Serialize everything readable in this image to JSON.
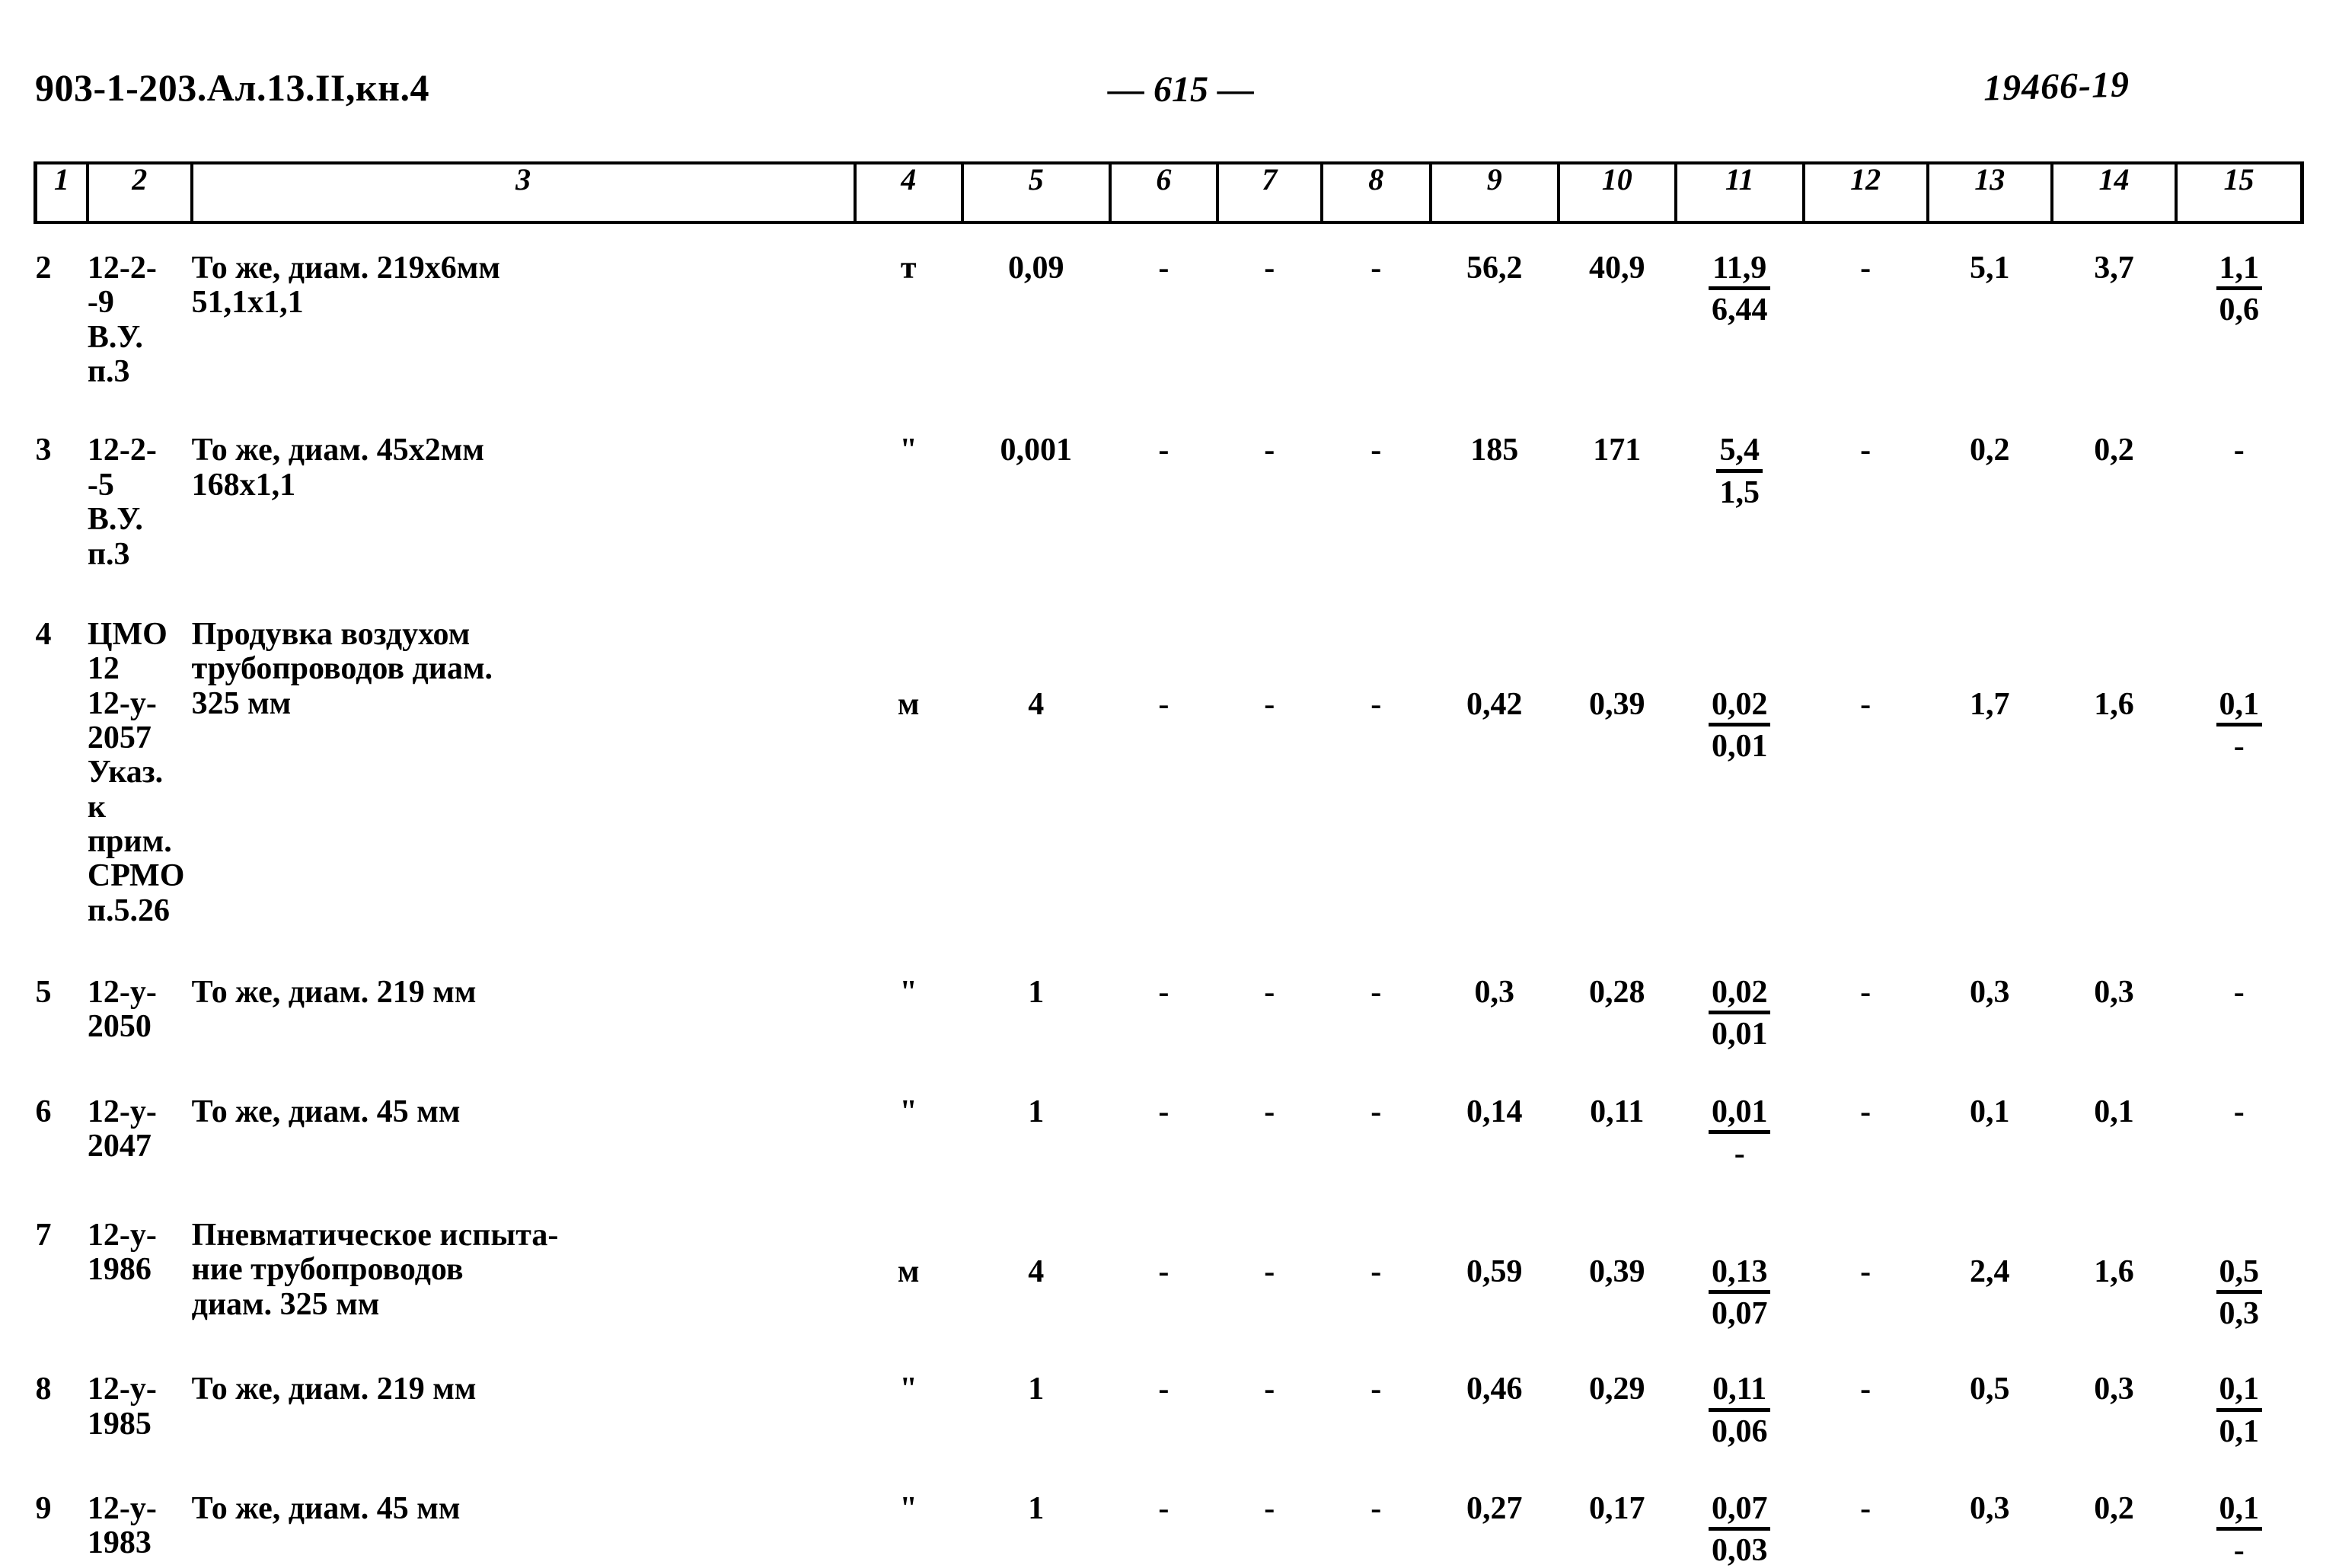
{
  "header": {
    "doc_code": "903-1-203.Ал.13.II,кн.4",
    "page_number": "— 615 —",
    "stamp_number": "19466-19"
  },
  "table": {
    "column_headers": [
      "1",
      "2",
      "3",
      "4",
      "5",
      "6",
      "7",
      "8",
      "9",
      "10",
      "11",
      "12",
      "13",
      "14",
      "15"
    ],
    "rows": [
      {
        "num": "2",
        "code": "12-2-\n  -9\n В.У.\n п.3",
        "desc": "То же, диам. 219х6мм\n51,1х1,1",
        "unit": "т",
        "c5": "0,09",
        "c6": "-",
        "c7": "-",
        "c8": "-",
        "c9": "56,2",
        "c10": "40,9",
        "c11_top": "11,9",
        "c11_bot": "6,44",
        "c12": "-",
        "c13": "5,1",
        "c14": "3,7",
        "c15_top": "1,1",
        "c15_bot": "0,6"
      },
      {
        "num": "3",
        "code": "12-2-\n  -5\n В.У.\n п.3",
        "desc": "То же, диам. 45х2мм\n168х1,1",
        "unit": "\"",
        "c5": "0,001",
        "c6": "-",
        "c7": "-",
        "c8": "-",
        "c9": "185",
        "c10": "171",
        "c11_top": "5,4",
        "c11_bot": "1,5",
        "c12": "-",
        "c13": "0,2",
        "c14": "0,2",
        "c15_top": "-",
        "c15_bot": ""
      },
      {
        "num": "4",
        "code": "ЦМО 12\n12-у-\n2057\nУказ.\nк прим.\nСРМО\nп.5.26",
        "desc": "Продувка воздухом\nтрубопроводов диам.\n325 мм",
        "unit": "м",
        "c5": "4",
        "c6": "-",
        "c7": "-",
        "c8": "-",
        "c9": "0,42",
        "c10": "0,39",
        "c11_top": "0,02",
        "c11_bot": "0,01",
        "c12": "-",
        "c13": "1,7",
        "c14": "1,6",
        "c15_top": "0,1",
        "c15_bot": "-"
      },
      {
        "num": "5",
        "code": "12-у-\n2050",
        "desc": "То же, диам. 219 мм",
        "unit": "\"",
        "c5": "1",
        "c6": "-",
        "c7": "-",
        "c8": "-",
        "c9": "0,3",
        "c10": "0,28",
        "c11_top": "0,02",
        "c11_bot": "0,01",
        "c12": "-",
        "c13": "0,3",
        "c14": "0,3",
        "c15_top": "-",
        "c15_bot": ""
      },
      {
        "num": "6",
        "code": "12-у-\n2047",
        "desc": "То же, диам. 45 мм",
        "unit": "\"",
        "c5": "1",
        "c6": "-",
        "c7": "-",
        "c8": "-",
        "c9": "0,14",
        "c10": "0,11",
        "c11_top": "0,01",
        "c11_bot": "-",
        "c12": "-",
        "c13": "0,1",
        "c14": "0,1",
        "c15_top": "-",
        "c15_bot": ""
      },
      {
        "num": "7",
        "code": "12-у-\n1986",
        "desc": "Пневматическое испыта-\nние трубопроводов\nдиам. 325 мм",
        "unit": "м",
        "c5": "4",
        "c6": "-",
        "c7": "-",
        "c8": "-",
        "c9": "0,59",
        "c10": "0,39",
        "c11_top": "0,13",
        "c11_bot": "0,07",
        "c12": "-",
        "c13": "2,4",
        "c14": "1,6",
        "c15_top": "0,5",
        "c15_bot": "0,3"
      },
      {
        "num": "8",
        "code": "12-у-\n1985",
        "desc": "То же, диам. 219 мм",
        "unit": "\"",
        "c5": "1",
        "c6": "-",
        "c7": "-",
        "c8": "-",
        "c9": "0,46",
        "c10": "0,29",
        "c11_top": "0,11",
        "c11_bot": "0,06",
        "c12": "-",
        "c13": "0,5",
        "c14": "0,3",
        "c15_top": "0,1",
        "c15_bot": "0,1"
      },
      {
        "num": "9",
        "code": "12-у-\n1983",
        "desc": "То же, диам. 45 мм",
        "unit": "\"",
        "c5": "1",
        "c6": "-",
        "c7": "-",
        "c8": "-",
        "c9": "0,27",
        "c10": "0,17",
        "c11_top": "0,07",
        "c11_bot": "0,03",
        "c12": "-",
        "c13": "0,3",
        "c14": "0,2",
        "c15_top": "0,1",
        "c15_bot": "-"
      }
    ]
  }
}
